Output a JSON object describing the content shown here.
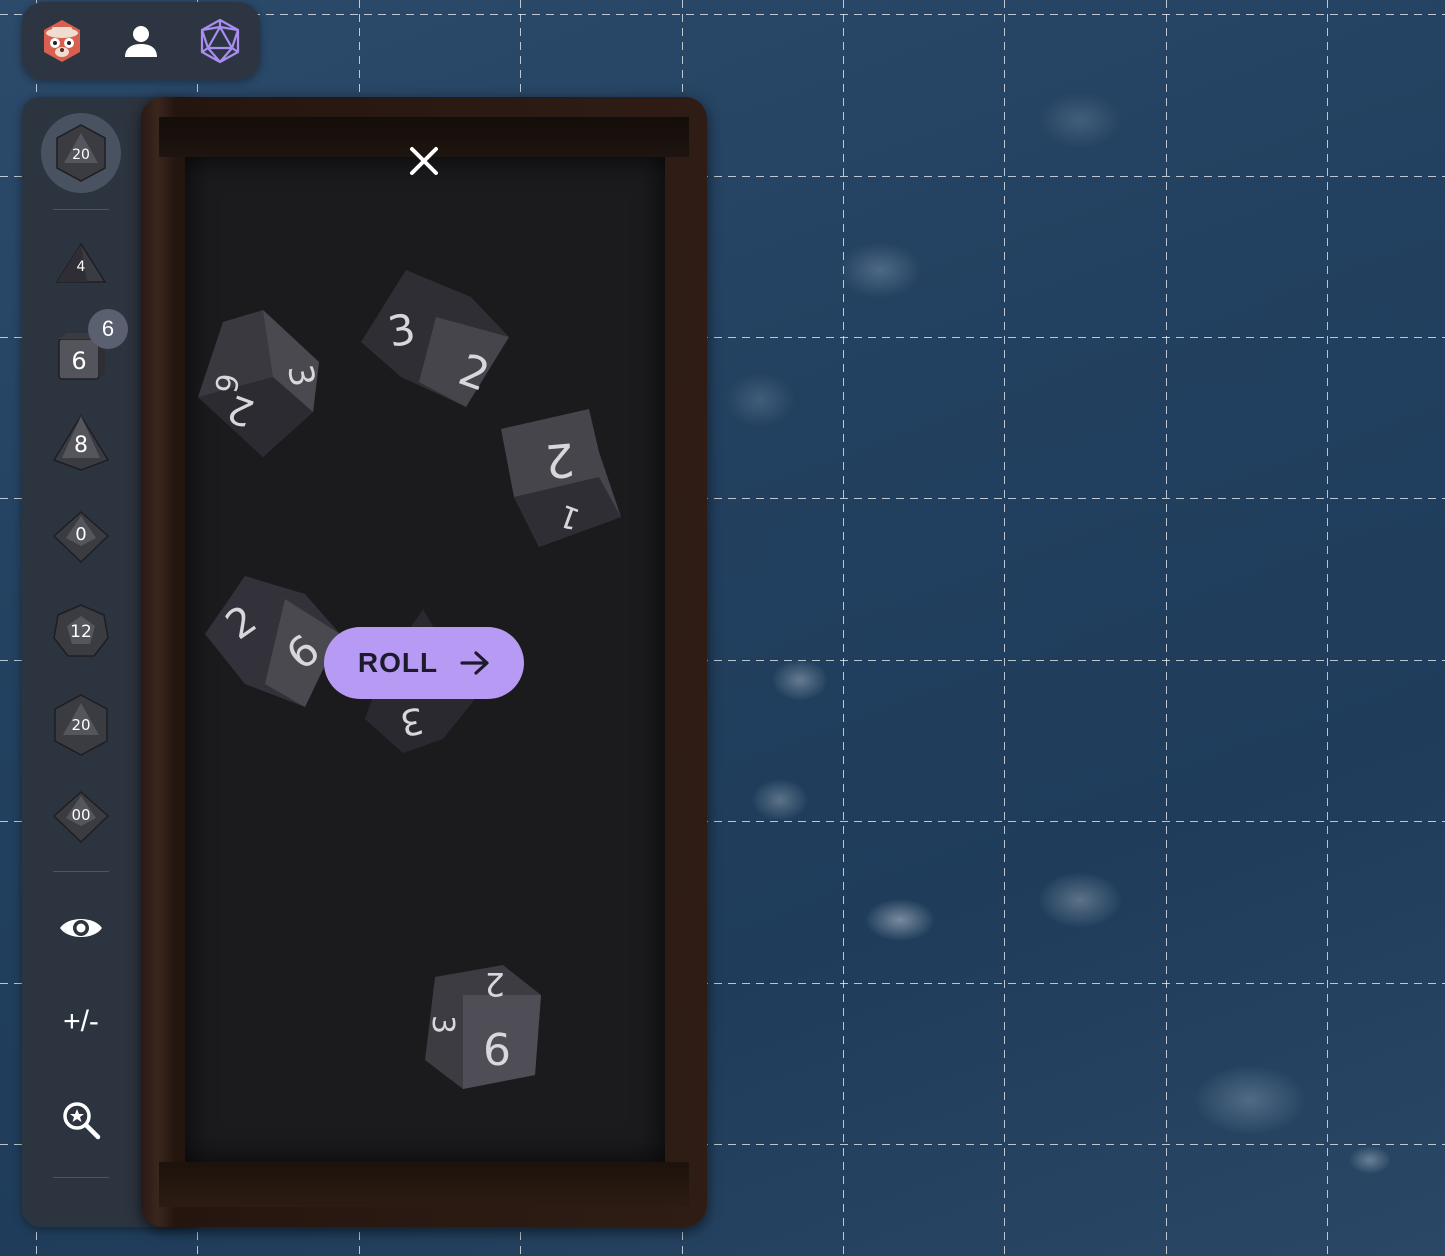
{
  "topbar": {
    "icons": [
      "owlbear-logo-icon",
      "player-icon",
      "dice-icon"
    ]
  },
  "sidebar": {
    "active_die_label": "20",
    "dice": [
      {
        "name": "d4",
        "label": "4"
      },
      {
        "name": "d6",
        "label": "6",
        "count": "6"
      },
      {
        "name": "d8",
        "label": "8"
      },
      {
        "name": "d10",
        "label": "0"
      },
      {
        "name": "d12",
        "label": "12"
      },
      {
        "name": "d20",
        "label": "20"
      },
      {
        "name": "d100",
        "label": "00"
      }
    ],
    "tools": {
      "visibility_icon": "eye-icon",
      "modifier_label": "+/-",
      "advantage_icon": "zoom-star-icon"
    }
  },
  "tray": {
    "roll_label": "ROLL",
    "dice_faces": [
      "3",
      "2",
      "6",
      "2",
      "2",
      "1",
      "2",
      "6",
      "3",
      "2",
      "3",
      "6"
    ]
  },
  "colors": {
    "accent": "#b79af4",
    "panel": "#2c3440",
    "tray_felt": "#1b1a1d"
  }
}
